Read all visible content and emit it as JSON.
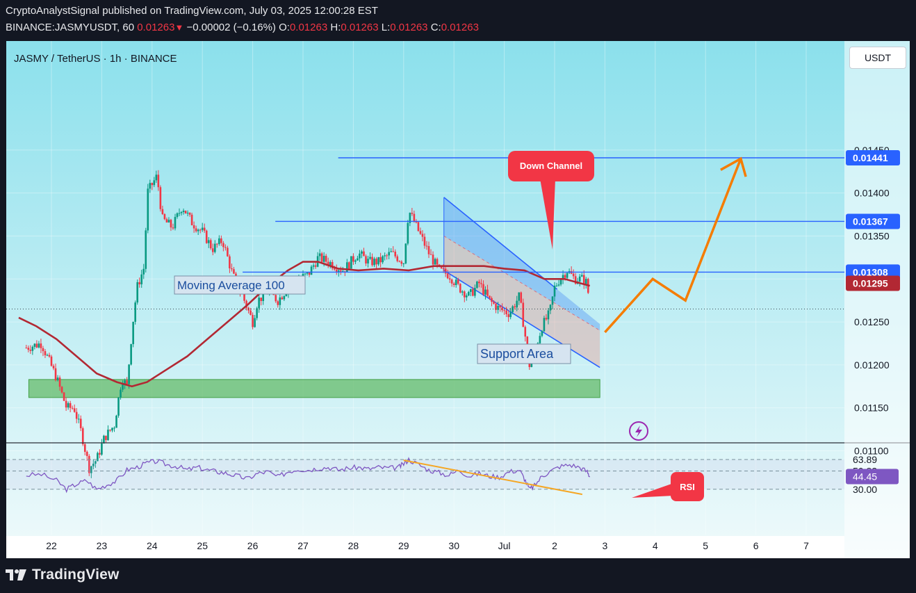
{
  "header": {
    "published": "CryptoAnalystSignal published on TradingView.com, July 03, 2025 12:00:28 EST",
    "symbol_interval": "BINANCE:JASMYUSDT, 60",
    "last": "0.01263",
    "change": "−0.00002 (−0.16%)",
    "o_label": "O:",
    "o": "0.01263",
    "h_label": "H:",
    "h": "0.01263",
    "l_label": "L:",
    "l": "0.01263",
    "c_label": "C:",
    "c": "0.01263"
  },
  "chart_title": "JASMY / TetherUS · 1h · BINANCE",
  "currency_button": "USDT",
  "footer": {
    "brand": "TradingView"
  },
  "colors": {
    "bg_top": "#8be0ec",
    "bg_bottom": "#eef9fb",
    "up": "#089981",
    "down": "#f23645",
    "ma": "#b22833",
    "rsi": "#7e57c2",
    "projection": "#f57c00",
    "level_line": "#2962ff",
    "support": "#66bb6a",
    "channel": "#2962ff"
  },
  "chart_data": {
    "type": "candlestick",
    "x_ticks": [
      "22",
      "23",
      "24",
      "25",
      "26",
      "27",
      "28",
      "29",
      "30",
      "Jul",
      "2",
      "3",
      "4",
      "5",
      "6",
      "7"
    ],
    "y_ticks": [
      "0.01450",
      "0.01400",
      "0.01350",
      "0.01250",
      "0.01200",
      "0.01150",
      "0.01100"
    ],
    "y_range": [
      0.0107,
      0.0151
    ],
    "x_range_days": [
      21.5,
      28.2
    ],
    "current_price_dotted": 0.01265,
    "price_labels": [
      {
        "value": 0.01441,
        "text": "0.01441",
        "color": "#2962ff"
      },
      {
        "value": 0.01367,
        "text": "0.01367",
        "color": "#2962ff"
      },
      {
        "value": 0.01308,
        "text": "0.01308",
        "color": "#2962ff"
      },
      {
        "value": 0.01295,
        "text": "0.01295",
        "color": "#b22833"
      }
    ],
    "horizontal_levels": [
      {
        "value": 0.01441,
        "x_start_day": 27.7
      },
      {
        "value": 0.01367,
        "x_start_day": 26.45
      },
      {
        "value": 0.01308,
        "x_start_day": 25.8
      }
    ],
    "price_path": [
      [
        21.5,
        0.0122
      ],
      [
        21.8,
        0.01225
      ],
      [
        22.1,
        0.01185
      ],
      [
        22.3,
        0.0115
      ],
      [
        22.45,
        0.0115
      ],
      [
        22.6,
        0.0112
      ],
      [
        22.75,
        0.0108
      ],
      [
        22.9,
        0.0109
      ],
      [
        23.05,
        0.01115
      ],
      [
        23.25,
        0.0113
      ],
      [
        23.4,
        0.01185
      ],
      [
        23.5,
        0.01175
      ],
      [
        23.6,
        0.0124
      ],
      [
        23.7,
        0.0129
      ],
      [
        23.85,
        0.01315
      ],
      [
        23.9,
        0.014
      ],
      [
        24.1,
        0.0142
      ],
      [
        24.2,
        0.0137
      ],
      [
        24.4,
        0.0136
      ],
      [
        24.6,
        0.01385
      ],
      [
        24.8,
        0.01365
      ],
      [
        25.0,
        0.01355
      ],
      [
        25.2,
        0.01335
      ],
      [
        25.4,
        0.01345
      ],
      [
        25.6,
        0.01305
      ],
      [
        25.8,
        0.0128
      ],
      [
        26.0,
        0.0125
      ],
      [
        26.1,
        0.01275
      ],
      [
        26.3,
        0.01285
      ],
      [
        26.5,
        0.01275
      ],
      [
        26.7,
        0.0129
      ],
      [
        26.9,
        0.013
      ],
      [
        27.1,
        0.01305
      ],
      [
        27.3,
        0.01325
      ],
      [
        27.5,
        0.0132
      ],
      [
        27.8,
        0.0131
      ],
      [
        28.1,
        0.0133
      ],
      [
        28.3,
        0.0132
      ],
      [
        28.5,
        0.0132
      ],
      [
        28.75,
        0.0133
      ],
      [
        29.0,
        0.0132
      ],
      [
        29.1,
        0.0138
      ],
      [
        29.3,
        0.01355
      ],
      [
        29.5,
        0.0133
      ],
      [
        29.7,
        0.0131
      ],
      [
        29.9,
        0.01305
      ],
      [
        30.1,
        0.0129
      ],
      [
        30.3,
        0.0128
      ],
      [
        30.5,
        0.01295
      ],
      [
        30.7,
        0.01275
      ],
      [
        30.9,
        0.01265
      ],
      [
        31.1,
        0.0126
      ],
      [
        31.3,
        0.0128
      ],
      [
        31.4,
        0.0124
      ],
      [
        31.5,
        0.012
      ],
      [
        31.6,
        0.01215
      ],
      [
        31.75,
        0.01245
      ],
      [
        31.9,
        0.0126
      ],
      [
        32.0,
        0.0129
      ],
      [
        32.1,
        0.013
      ],
      [
        32.25,
        0.0131
      ],
      [
        32.4,
        0.013
      ],
      [
        32.55,
        0.013
      ],
      [
        32.65,
        0.01295
      ],
      [
        32.7,
        0.01263
      ]
    ],
    "moving_average": {
      "label": "Moving Average 100",
      "points": [
        [
          21.35,
          0.01255
        ],
        [
          21.7,
          0.01245
        ],
        [
          22.1,
          0.0123
        ],
        [
          22.5,
          0.0121
        ],
        [
          22.9,
          0.0119
        ],
        [
          23.3,
          0.0118
        ],
        [
          23.6,
          0.01175
        ],
        [
          23.9,
          0.0118
        ],
        [
          24.3,
          0.01195
        ],
        [
          24.7,
          0.0121
        ],
        [
          25.1,
          0.0123
        ],
        [
          25.5,
          0.0125
        ],
        [
          25.9,
          0.0127
        ],
        [
          26.3,
          0.01292
        ],
        [
          26.7,
          0.0131
        ],
        [
          27.0,
          0.0132
        ],
        [
          27.3,
          0.0132
        ],
        [
          27.7,
          0.01312
        ],
        [
          28.1,
          0.0131
        ],
        [
          28.6,
          0.01312
        ],
        [
          29.1,
          0.0131
        ],
        [
          29.6,
          0.01315
        ],
        [
          30.1,
          0.01315
        ],
        [
          30.6,
          0.01315
        ],
        [
          31.0,
          0.01312
        ],
        [
          31.4,
          0.0131
        ],
        [
          31.8,
          0.013
        ],
        [
          32.2,
          0.013
        ],
        [
          32.7,
          0.01292
        ]
      ]
    },
    "support_area": {
      "label": "Support Area",
      "low": 0.01162,
      "high": 0.01183,
      "x_start_day": 21.55,
      "x_end_day": 32.9
    },
    "down_channel": {
      "label": "Down Channel",
      "upper": [
        [
          29.8,
          0.01395
        ],
        [
          32.05,
          0.01288
        ]
      ],
      "lower": [
        [
          29.8,
          0.0131
        ],
        [
          32.9,
          0.01197
        ]
      ],
      "fill_split": [
        [
          29.8,
          0.0135
        ],
        [
          32.9,
          0.0124
        ]
      ]
    },
    "projection": {
      "points": [
        [
          33.0,
          0.01238
        ],
        [
          33.95,
          0.013
        ],
        [
          34.6,
          0.01275
        ],
        [
          35.7,
          0.0144
        ]
      ],
      "arrowhead": [
        [
          35.3,
          0.01427
        ],
        [
          35.7,
          0.0144
        ],
        [
          35.8,
          0.01419
        ]
      ]
    },
    "rsi": {
      "label": "RSI",
      "y_ticks": [
        "63.89",
        "50.82",
        "30.00"
      ],
      "current": "44.45",
      "levels": [
        63.89,
        50.82,
        30.0
      ],
      "y_range": [
        10,
        75
      ],
      "series": [
        [
          21.5,
          46
        ],
        [
          21.8,
          47
        ],
        [
          22.1,
          40
        ],
        [
          22.3,
          30
        ],
        [
          22.5,
          36
        ],
        [
          22.7,
          40
        ],
        [
          22.9,
          30
        ],
        [
          23.1,
          35
        ],
        [
          23.3,
          40
        ],
        [
          23.5,
          52
        ],
        [
          23.7,
          55
        ],
        [
          23.9,
          60
        ],
        [
          24.1,
          62
        ],
        [
          24.3,
          58
        ],
        [
          24.5,
          56
        ],
        [
          24.7,
          52
        ],
        [
          24.9,
          55
        ],
        [
          25.1,
          52
        ],
        [
          25.3,
          50
        ],
        [
          25.5,
          48
        ],
        [
          25.7,
          45
        ],
        [
          25.9,
          42
        ],
        [
          26.1,
          48
        ],
        [
          26.3,
          50
        ],
        [
          26.5,
          44
        ],
        [
          26.7,
          50
        ],
        [
          26.9,
          53
        ],
        [
          27.1,
          52
        ],
        [
          27.3,
          54
        ],
        [
          27.5,
          55
        ],
        [
          27.7,
          52
        ],
        [
          27.9,
          54
        ],
        [
          28.1,
          55
        ],
        [
          28.3,
          53
        ],
        [
          28.5,
          55
        ],
        [
          28.7,
          54
        ],
        [
          28.9,
          55
        ],
        [
          29.0,
          59
        ],
        [
          29.1,
          64
        ],
        [
          29.3,
          58
        ],
        [
          29.5,
          52
        ],
        [
          29.7,
          49
        ],
        [
          29.9,
          46
        ],
        [
          30.1,
          52
        ],
        [
          30.3,
          45
        ],
        [
          30.5,
          48
        ],
        [
          30.7,
          45
        ],
        [
          30.9,
          44
        ],
        [
          31.1,
          50
        ],
        [
          31.3,
          52
        ],
        [
          31.4,
          42
        ],
        [
          31.5,
          30
        ],
        [
          31.6,
          34
        ],
        [
          31.75,
          45
        ],
        [
          31.9,
          50
        ],
        [
          32.1,
          56
        ],
        [
          32.3,
          58
        ],
        [
          32.5,
          55
        ],
        [
          32.65,
          50
        ],
        [
          32.7,
          44
        ]
      ],
      "divergence": [
        [
          29.0,
          63
        ],
        [
          32.55,
          40
        ]
      ]
    }
  }
}
